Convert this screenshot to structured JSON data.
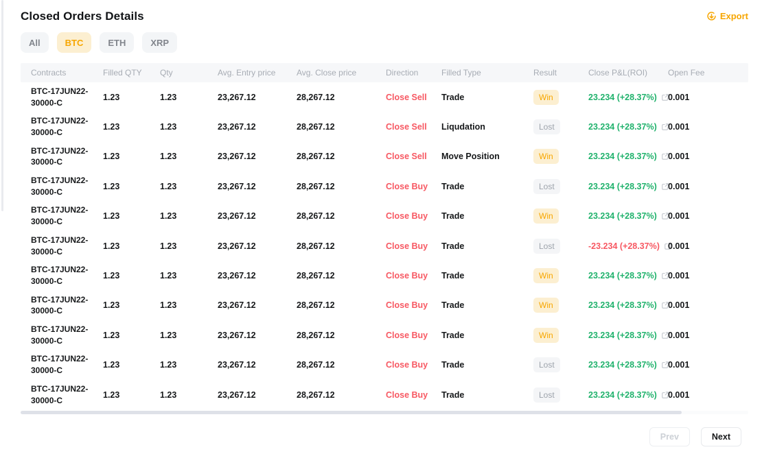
{
  "page": {
    "title": "Closed Orders Details",
    "export_label": "Export"
  },
  "filters": [
    {
      "label": "All",
      "active": false
    },
    {
      "label": "BTC",
      "active": true
    },
    {
      "label": "ETH",
      "active": false
    },
    {
      "label": "XRP",
      "active": false
    }
  ],
  "table": {
    "columns": [
      "Contracts",
      "Filled QTY",
      "Qty",
      "Avg. Entry price",
      "Avg. Close price",
      "Direction",
      "Filled Type",
      "Result",
      "Close P&L(ROI)",
      "Open Fee"
    ],
    "rows": [
      {
        "contract": "BTC-17JUN22-30000-C",
        "filled_qty": "1.23",
        "qty": "1.23",
        "avg_entry": "23,267.12",
        "avg_close": "28,267.12",
        "direction": "Close Sell",
        "filled_type": "Trade",
        "result": "Win",
        "pnl": "23.234 (+28.37%)",
        "pnl_negative": false,
        "open_fee": "0.001"
      },
      {
        "contract": "BTC-17JUN22-30000-C",
        "filled_qty": "1.23",
        "qty": "1.23",
        "avg_entry": "23,267.12",
        "avg_close": "28,267.12",
        "direction": "Close Sell",
        "filled_type": "Liqudation",
        "result": "Lost",
        "pnl": "23.234 (+28.37%)",
        "pnl_negative": false,
        "open_fee": "0.001"
      },
      {
        "contract": "BTC-17JUN22-30000-C",
        "filled_qty": "1.23",
        "qty": "1.23",
        "avg_entry": "23,267.12",
        "avg_close": "28,267.12",
        "direction": "Close Sell",
        "filled_type": "Move Position",
        "result": "Win",
        "pnl": "23.234 (+28.37%)",
        "pnl_negative": false,
        "open_fee": "0.001"
      },
      {
        "contract": "BTC-17JUN22-30000-C",
        "filled_qty": "1.23",
        "qty": "1.23",
        "avg_entry": "23,267.12",
        "avg_close": "28,267.12",
        "direction": "Close Buy",
        "filled_type": "Trade",
        "result": "Lost",
        "pnl": "23.234 (+28.37%)",
        "pnl_negative": false,
        "open_fee": "0.001"
      },
      {
        "contract": "BTC-17JUN22-30000-C",
        "filled_qty": "1.23",
        "qty": "1.23",
        "avg_entry": "23,267.12",
        "avg_close": "28,267.12",
        "direction": "Close Buy",
        "filled_type": "Trade",
        "result": "Win",
        "pnl": "23.234 (+28.37%)",
        "pnl_negative": false,
        "open_fee": "0.001"
      },
      {
        "contract": "BTC-17JUN22-30000-C",
        "filled_qty": "1.23",
        "qty": "1.23",
        "avg_entry": "23,267.12",
        "avg_close": "28,267.12",
        "direction": "Close Buy",
        "filled_type": "Trade",
        "result": "Lost",
        "pnl": "-23.234 (+28.37%)",
        "pnl_negative": true,
        "open_fee": "0.001"
      },
      {
        "contract": "BTC-17JUN22-30000-C",
        "filled_qty": "1.23",
        "qty": "1.23",
        "avg_entry": "23,267.12",
        "avg_close": "28,267.12",
        "direction": "Close Buy",
        "filled_type": "Trade",
        "result": "Win",
        "pnl": "23.234 (+28.37%)",
        "pnl_negative": false,
        "open_fee": "0.001"
      },
      {
        "contract": "BTC-17JUN22-30000-C",
        "filled_qty": "1.23",
        "qty": "1.23",
        "avg_entry": "23,267.12",
        "avg_close": "28,267.12",
        "direction": "Close Buy",
        "filled_type": "Trade",
        "result": "Win",
        "pnl": "23.234 (+28.37%)",
        "pnl_negative": false,
        "open_fee": "0.001"
      },
      {
        "contract": "BTC-17JUN22-30000-C",
        "filled_qty": "1.23",
        "qty": "1.23",
        "avg_entry": "23,267.12",
        "avg_close": "28,267.12",
        "direction": "Close Buy",
        "filled_type": "Trade",
        "result": "Win",
        "pnl": "23.234 (+28.37%)",
        "pnl_negative": false,
        "open_fee": "0.001"
      },
      {
        "contract": "BTC-17JUN22-30000-C",
        "filled_qty": "1.23",
        "qty": "1.23",
        "avg_entry": "23,267.12",
        "avg_close": "28,267.12",
        "direction": "Close Buy",
        "filled_type": "Trade",
        "result": "Lost",
        "pnl": "23.234 (+28.37%)",
        "pnl_negative": false,
        "open_fee": "0.001"
      },
      {
        "contract": "BTC-17JUN22-30000-C",
        "filled_qty": "1.23",
        "qty": "1.23",
        "avg_entry": "23,267.12",
        "avg_close": "28,267.12",
        "direction": "Close Buy",
        "filled_type": "Trade",
        "result": "Lost",
        "pnl": "23.234 (+28.37%)",
        "pnl_negative": false,
        "open_fee": "0.001"
      }
    ]
  },
  "pagination": {
    "prev_label": "Prev",
    "next_label": "Next",
    "prev_disabled": true
  },
  "colors": {
    "accent": "#f7a600",
    "up": "#20b26c",
    "down": "#f75862",
    "win-bg": "#fcefd1"
  }
}
